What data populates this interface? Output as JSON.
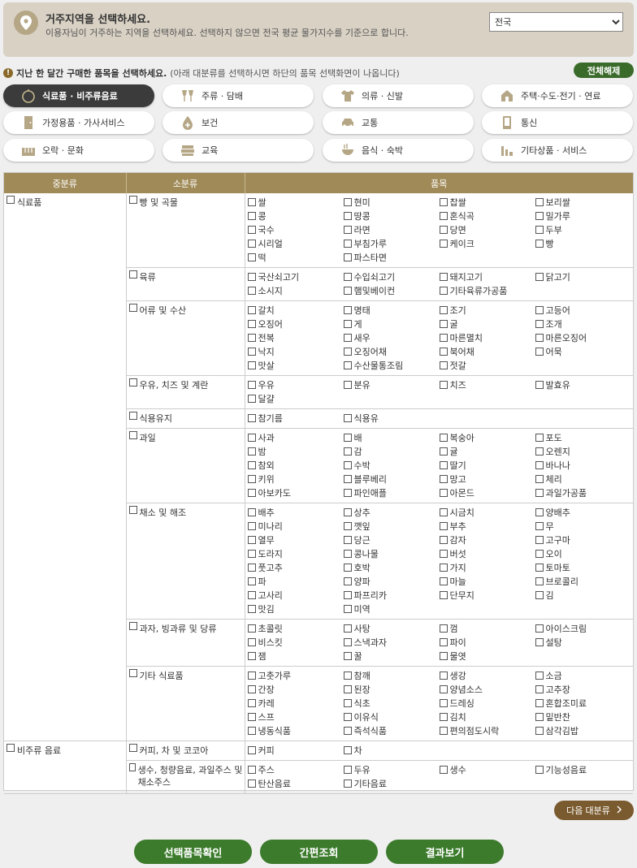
{
  "region": {
    "title": "거주지역을 선택하세요.",
    "desc": "이용자님이 거주하는 지역을 선택하세요. 선택하지 않으면 전국 평균 물가지수를 기준으로 합니다.",
    "selected": "전국"
  },
  "notice": {
    "strong": "지난 한 달간 구매한 품목을 선택하세요.",
    "rest": "(아래 대분류를 선택하시면 하단의 품목 선택화면이 나옵니다)"
  },
  "reset_label": "전체해제",
  "categories": [
    {
      "label": "식료품 · 비주류음료",
      "icon": "apple-icon"
    },
    {
      "label": "주류 · 담배",
      "icon": "wine-glass-icon"
    },
    {
      "label": "의류 · 신발",
      "icon": "shirt-icon"
    },
    {
      "label": "주택·수도·전기 · 연료",
      "icon": "house-icon"
    },
    {
      "label": "가정용품 · 가사서비스",
      "icon": "door-icon"
    },
    {
      "label": "보건",
      "icon": "medical-drop-icon"
    },
    {
      "label": "교통",
      "icon": "car-icon"
    },
    {
      "label": "통신",
      "icon": "phone-icon"
    },
    {
      "label": "오락 · 문화",
      "icon": "piano-icon"
    },
    {
      "label": "교육",
      "icon": "books-icon"
    },
    {
      "label": "음식 · 숙박",
      "icon": "bowl-icon"
    },
    {
      "label": "기타상품 · 서비스",
      "icon": "misc-icon"
    }
  ],
  "table": {
    "headers": [
      "중분류",
      "소분류",
      "품목"
    ],
    "groups": [
      {
        "mid": "식료품",
        "subs": [
          {
            "name": "빵 및 곡물",
            "items": [
              "쌀",
              "현미",
              "찹쌀",
              "보리쌀",
              "콩",
              "땅콩",
              "혼식곡",
              "밀가루",
              "국수",
              "라면",
              "당면",
              "두부",
              "시리얼",
              "부침가루",
              "케이크",
              "빵",
              "떡",
              "파스타면"
            ]
          },
          {
            "name": "육류",
            "items": [
              "국산쇠고기",
              "수입쇠고기",
              "돼지고기",
              "닭고기",
              "소시지",
              "햄및베이컨",
              "기타육류가공품"
            ]
          },
          {
            "name": "어류 및 수산",
            "items": [
              "갈치",
              "명태",
              "조기",
              "고등어",
              "오징어",
              "게",
              "굴",
              "조개",
              "전복",
              "새우",
              "마른멸치",
              "마른오징어",
              "낙지",
              "오징어채",
              "북어채",
              "어묵",
              "맛살",
              "수산물통조림",
              "젓갈"
            ]
          },
          {
            "name": "우유, 치즈 및 계란",
            "items": [
              "우유",
              "분유",
              "치즈",
              "발효유",
              "달걀"
            ]
          },
          {
            "name": "식용유지",
            "items": [
              "참기름",
              "식용유"
            ]
          },
          {
            "name": "과일",
            "items": [
              "사과",
              "배",
              "복숭아",
              "포도",
              "밤",
              "감",
              "귤",
              "오렌지",
              "참외",
              "수박",
              "딸기",
              "바나나",
              "키위",
              "블루베리",
              "망고",
              "체리",
              "아보카도",
              "파인애플",
              "아몬드",
              "과일가공품"
            ]
          },
          {
            "name": "채소 및 해조",
            "items": [
              "배추",
              "상추",
              "시금치",
              "양배추",
              "미나리",
              "깻잎",
              "부추",
              "무",
              "열무",
              "당근",
              "감자",
              "고구마",
              "도라지",
              "콩나물",
              "버섯",
              "오이",
              "풋고추",
              "호박",
              "가지",
              "토마토",
              "파",
              "양파",
              "마늘",
              "브로콜리",
              "고사리",
              "파프리카",
              "단무지",
              "김",
              "맛김",
              "미역"
            ]
          },
          {
            "name": "과자, 빙과류 및 당류",
            "items": [
              "초콜릿",
              "사탕",
              "껌",
              "아이스크림",
              "비스킷",
              "스낵과자",
              "파이",
              "설탕",
              "잼",
              "꿀",
              "물엿"
            ]
          },
          {
            "name": "기타 식료품",
            "items": [
              "고춧가루",
              "참깨",
              "생강",
              "소금",
              "간장",
              "된장",
              "양념소스",
              "고추장",
              "카레",
              "식초",
              "드레싱",
              "혼합조미료",
              "스프",
              "이유식",
              "김치",
              "밑반찬",
              "냉동식품",
              "즉석식품",
              "편의점도시락",
              "삼각김밥"
            ]
          }
        ]
      },
      {
        "mid": "비주류 음료",
        "subs": [
          {
            "name": "커피, 차 및 코코아",
            "items": [
              "커피",
              "차"
            ]
          },
          {
            "name": "생수, 청량음료, 과일주스 및 채소주스",
            "items": [
              "주스",
              "두유",
              "생수",
              "기능성음료",
              "탄산음료",
              "기타음료"
            ]
          }
        ]
      }
    ]
  },
  "next_label": "다음 대분류",
  "bottom_buttons": [
    "선택품목확인",
    "간편조회",
    "결과보기"
  ]
}
